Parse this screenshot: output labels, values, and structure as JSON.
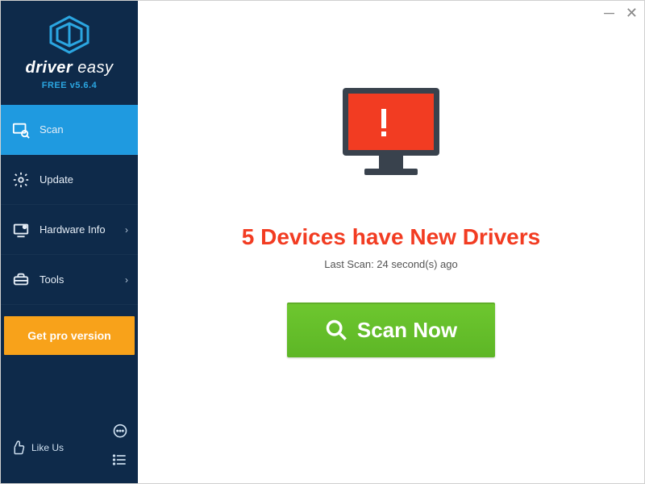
{
  "brand": {
    "line1_a": "driver",
    "line1_b": " easy",
    "version": "FREE v5.6.4"
  },
  "sidebar": {
    "items": [
      {
        "label": "Scan"
      },
      {
        "label": "Update"
      },
      {
        "label": "Hardware Info"
      },
      {
        "label": "Tools"
      }
    ],
    "getpro": "Get pro version",
    "likeus": "Like Us"
  },
  "main": {
    "headline": "5 Devices have New Drivers",
    "lastscan": "Last Scan: 24 second(s) ago",
    "scan_button": "Scan Now"
  },
  "colors": {
    "sidebar_bg": "#0e2a4a",
    "active": "#1f9ae0",
    "accent_orange": "#f8a21a",
    "alert_red": "#f23c22",
    "scan_green": "#5db626"
  }
}
